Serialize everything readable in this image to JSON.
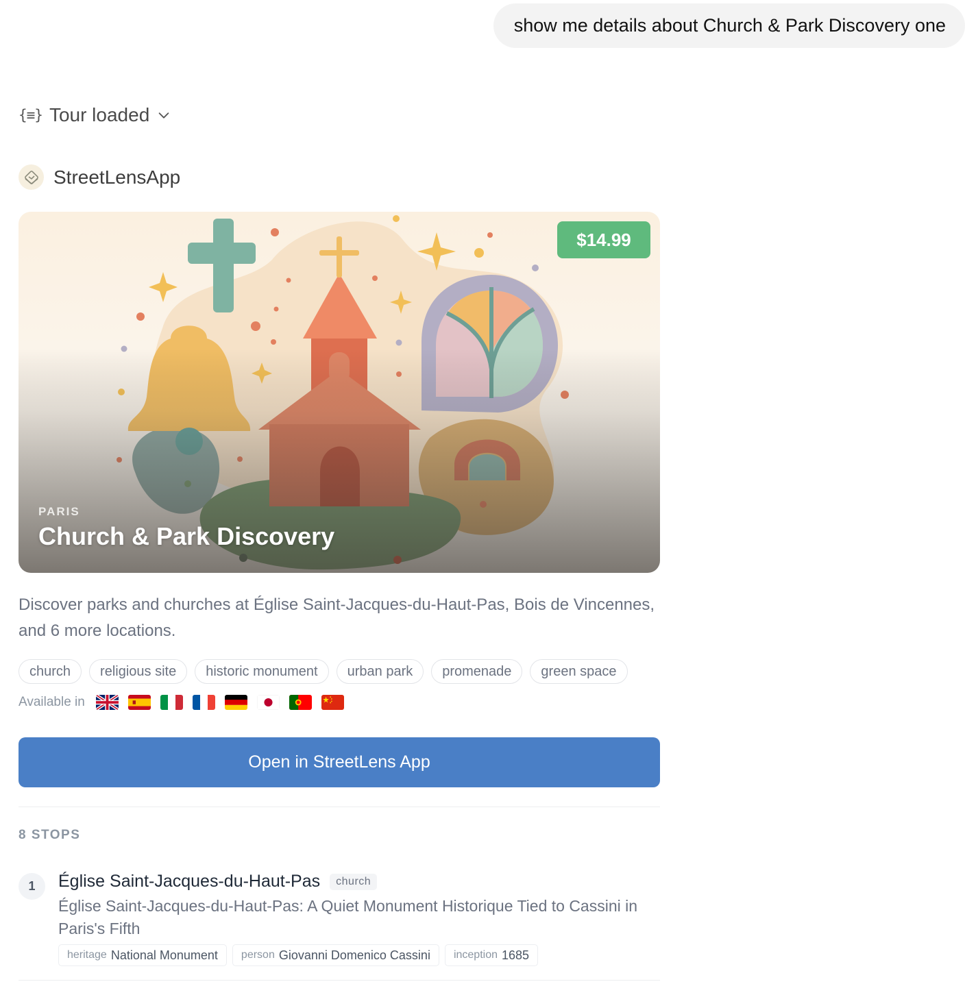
{
  "user_message": "show me details about Church & Park Discovery one",
  "tool_status": {
    "label": "Tour loaded",
    "icon": "braces-icon"
  },
  "app": {
    "name": "StreetLensApp"
  },
  "tour": {
    "price": "$14.99",
    "city": "PARIS",
    "title": "Church & Park Discovery",
    "description": "Discover parks and churches at Église Saint-Jacques-du-Haut-Pas, Bois de Vincennes, and 6 more locations.",
    "tags": [
      "church",
      "religious site",
      "historic monument",
      "urban park",
      "promenade",
      "green space"
    ],
    "available_label": "Available in",
    "languages": [
      "gb",
      "es",
      "it",
      "fr",
      "de",
      "jp",
      "pt",
      "cn"
    ],
    "cta_label": "Open in StreetLens App",
    "price_color": "#5fba7d",
    "cta_color": "#4a7fc6"
  },
  "stops": {
    "count_label": "8 STOPS",
    "items": [
      {
        "number": "1",
        "title": "Église Saint-Jacques-du-Haut-Pas",
        "type": "church",
        "subtitle": "Église Saint-Jacques-du-Haut-Pas: A Quiet Monument Historique Tied to Cassini in Paris's Fifth",
        "facts": [
          {
            "key": "heritage",
            "value": "National Monument"
          },
          {
            "key": "person",
            "value": "Giovanni Domenico Cassini"
          },
          {
            "key": "inception",
            "value": "1685"
          }
        ]
      }
    ]
  }
}
